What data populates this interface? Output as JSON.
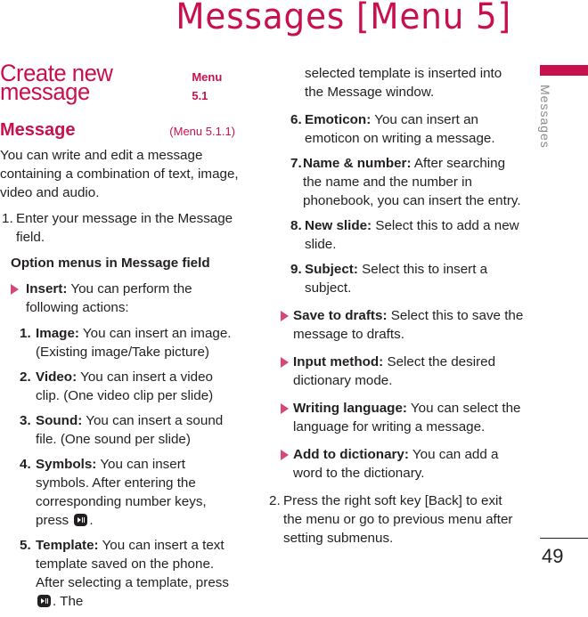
{
  "header": {
    "title": "Messages [Menu 5]"
  },
  "side_tab": {
    "label": "Messages",
    "accent_color": "#c8104f"
  },
  "page_number": "49",
  "section": {
    "title": "Create new message",
    "menu_ref": "Menu 5.1",
    "subsection": {
      "title": "Message",
      "menu_ref": "(Menu 5.1.1)"
    },
    "intro": "You can write and edit a message containing a combination of text, image, video and audio.",
    "step1": {
      "num": "1.",
      "text": "Enter your message in the Message field."
    },
    "option_heading": "Option menus in Message field",
    "insert": {
      "label": "Insert:",
      "text": "You can perform the following actions:"
    },
    "insert_items": [
      {
        "num": "1.",
        "label": "Image:",
        "text": "You can insert an image. (Existing image/Take picture)"
      },
      {
        "num": "2.",
        "label": "Video:",
        "text": "You can insert a video clip. (One video clip per slide)"
      },
      {
        "num": "3.",
        "label": "Sound:",
        "text": "You can insert a sound file. (One sound per slide)"
      },
      {
        "num": "4.",
        "label": "Symbols:",
        "text_before": "You can insert symbols. After entering the corresponding number keys, press",
        "text_after": "."
      },
      {
        "num": "5.",
        "label": "Template:",
        "text_before": "You can insert a text template saved on the phone. After selecting a template, press",
        "text_after": ". The",
        "continued": "selected template is inserted into the Message window."
      },
      {
        "num": "6.",
        "label": "Emoticon:",
        "text": "You can insert an emoticon on writing a message."
      },
      {
        "num": "7.",
        "label": "Name & number:",
        "text": "After searching the name and the number in phonebook, you can insert the entry."
      },
      {
        "num": "8.",
        "label": "New slide:",
        "text": "Select this to add a new slide."
      },
      {
        "num": "9.",
        "label": "Subject:",
        "text": "Select this to insert a subject."
      }
    ],
    "bullets": [
      {
        "label": "Save to drafts:",
        "text": "Select this to save the message to drafts."
      },
      {
        "label": "Input method:",
        "text": "Select the desired dictionary mode."
      },
      {
        "label": "Writing language:",
        "text": "You can select the language for writing a message."
      },
      {
        "label": "Add to dictionary:",
        "text": "You can add a word to the dictionary."
      }
    ],
    "step2": {
      "num": "2.",
      "text": "Press the right soft key [Back] to exit the menu or go to previous menu after setting submenus."
    },
    "key_icon": "ok-play-pause-key-icon"
  }
}
